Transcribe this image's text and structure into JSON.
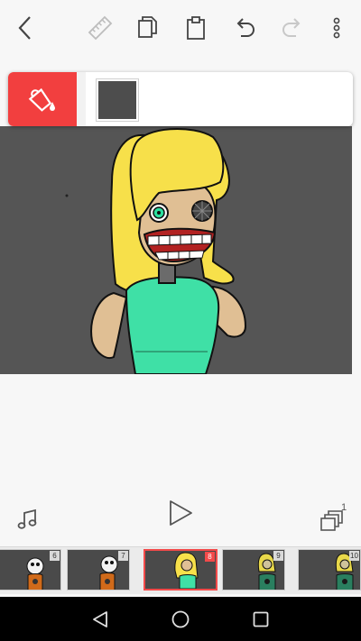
{
  "toolbar": {
    "icons": [
      "back-icon",
      "ruler-icon",
      "copy-icon",
      "paste-icon",
      "undo-icon",
      "redo-icon",
      "more-vert-icon"
    ]
  },
  "fill_panel": {
    "tool_icon": "paint-bucket-icon",
    "accent_color": "#f23f3f",
    "selected_color": "#4d4d4d"
  },
  "canvas": {
    "background_color": "#555555",
    "drawing": "blonde-character-drawing"
  },
  "controls": {
    "layers_count": "1",
    "icons": [
      "music-icon",
      "play-icon",
      "layers-icon"
    ]
  },
  "filmstrip": {
    "frames": [
      {
        "number": "6",
        "selected": false
      },
      {
        "number": "7",
        "selected": false
      },
      {
        "number": "8",
        "selected": true
      },
      {
        "number": "9",
        "selected": false
      },
      {
        "number": "10",
        "selected": false
      }
    ]
  },
  "navbar": {
    "icons": [
      "nav-back-icon",
      "nav-home-icon",
      "nav-recents-icon"
    ]
  }
}
